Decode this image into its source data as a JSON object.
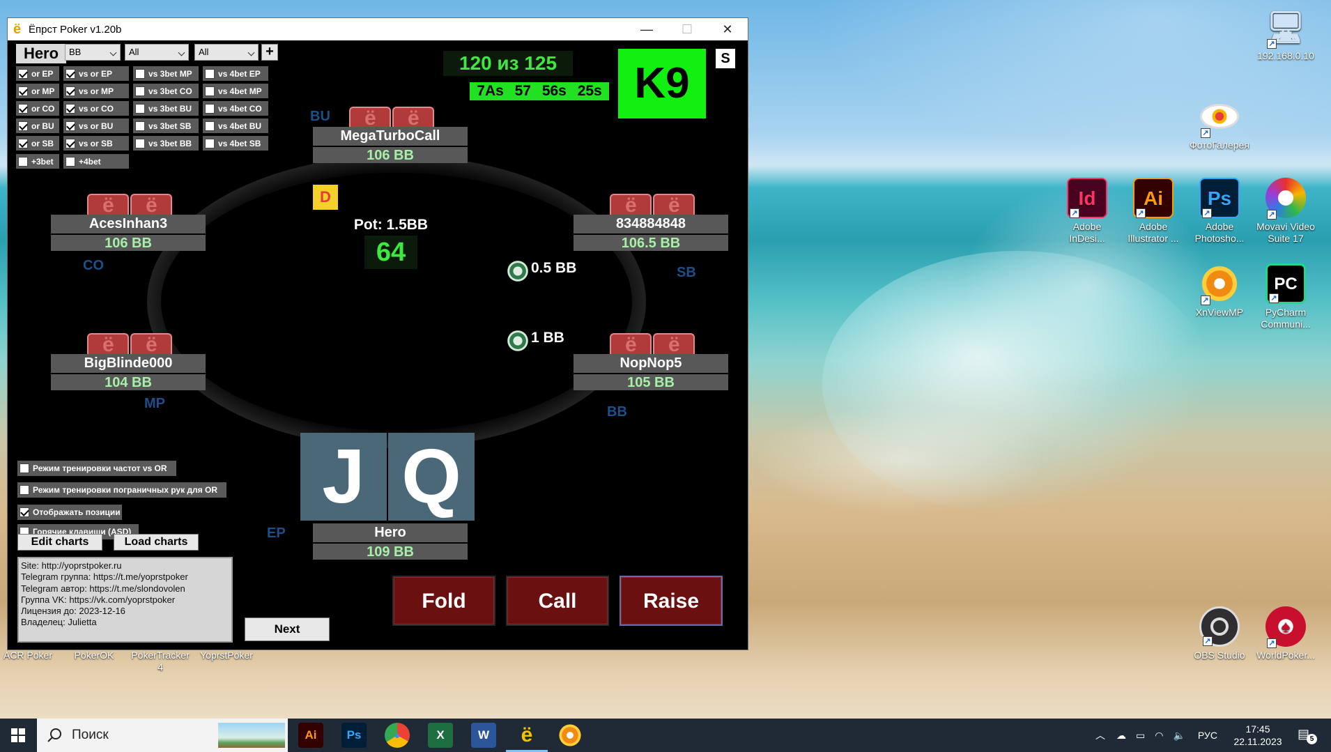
{
  "window": {
    "title": "Ёпрст Poker v1.20b",
    "icon_glyph": "ё",
    "minimize_glyph": "—",
    "maximize_glyph": "☐",
    "close_glyph": "✕"
  },
  "toolbar": {
    "hero_label": "Hero",
    "position_select": "BB",
    "filter_select_1": "All",
    "filter_select_2": "All",
    "add_label": "+"
  },
  "checkboxes": {
    "col1": [
      {
        "label": "or EP",
        "checked": true
      },
      {
        "label": "or MP",
        "checked": true
      },
      {
        "label": "or CO",
        "checked": true
      },
      {
        "label": "or BU",
        "checked": true
      },
      {
        "label": "or SB",
        "checked": true
      }
    ],
    "col2": [
      {
        "label": "vs or EP",
        "checked": true
      },
      {
        "label": "vs or MP",
        "checked": true
      },
      {
        "label": "vs or CO",
        "checked": true
      },
      {
        "label": "vs or BU",
        "checked": true
      },
      {
        "label": "vs or SB",
        "checked": true
      }
    ],
    "col3": [
      {
        "label": "vs 3bet MP",
        "checked": false
      },
      {
        "label": "vs 3bet CO",
        "checked": false
      },
      {
        "label": "vs 3bet BU",
        "checked": false
      },
      {
        "label": "vs 3bet SB",
        "checked": false
      },
      {
        "label": "vs 3bet BB",
        "checked": false
      }
    ],
    "col4": [
      {
        "label": "vs 4bet EP",
        "checked": false
      },
      {
        "label": "vs 4bet MP",
        "checked": false
      },
      {
        "label": "vs 4bet CO",
        "checked": false
      },
      {
        "label": "vs 4bet BU",
        "checked": false
      },
      {
        "label": "vs 4bet SB",
        "checked": false
      }
    ],
    "plus3bet": {
      "label": "+3bet",
      "checked": false
    },
    "plus4bet": {
      "label": "+4bet",
      "checked": false
    }
  },
  "stats": {
    "counter": "120 из 125",
    "line": "7As 57 56s 25s",
    "hand": "K9",
    "s_label": "S"
  },
  "table": {
    "pot": "Pot: 1.5BB",
    "timer": "64",
    "dealer": "D",
    "bets": {
      "sb": "0.5 BB",
      "bb": "1 BB"
    },
    "positions": {
      "bu": "BU",
      "co": "CO",
      "sb": "SB",
      "mp": "MP",
      "bb": "BB",
      "ep": "EP"
    },
    "players": {
      "top": {
        "name": "MegaTurboCall",
        "stack": "106 BB"
      },
      "left_top": {
        "name": "AcesInhan3",
        "stack": "106 BB"
      },
      "right_top": {
        "name": "834884848",
        "stack": "106.5 BB"
      },
      "left_bottom": {
        "name": "BigBlinde000",
        "stack": "104 BB"
      },
      "right_bottom": {
        "name": "NopNop5",
        "stack": "105 BB"
      },
      "hero": {
        "name": "Hero",
        "stack": "109 BB"
      }
    },
    "hero_cards": [
      "J",
      "Q"
    ]
  },
  "options": [
    {
      "label": "Режим тренировки частот vs OR",
      "checked": false
    },
    {
      "label": "Режим тренировки пограничных рук для OR",
      "checked": false
    },
    {
      "label": "Отображать позиции",
      "checked": true
    },
    {
      "label": "Горячие клавиши (ASD)",
      "checked": false
    }
  ],
  "buttons": {
    "edit_charts": "Edit charts",
    "load_charts": "Load charts",
    "next": "Next",
    "fold": "Fold",
    "call": "Call",
    "raise": "Raise"
  },
  "info_lines": [
    "Site: http://yoprstpoker.ru",
    "Telegram группа: https://t.me/yoprstpoker",
    "Telegram автор: https://t.me/slondovolen",
    "Группа VK: https://vk.com/yoprstpoker",
    "Лицензия до: 2023-12-16",
    "Владелец: Julietta"
  ],
  "desktop_icons": [
    {
      "label": "192.168.0.10",
      "glyph": "🖥",
      "color": "#cfe3f5"
    },
    {
      "label": "ФотоГалерея",
      "glyph": "◉",
      "color": "#e8e8e8"
    },
    {
      "label": "Adobe InDesi...",
      "glyph": "Id",
      "color": "#49021f"
    },
    {
      "label": "Adobe Illustrator ...",
      "glyph": "Ai",
      "color": "#330000"
    },
    {
      "label": "Adobe Photosho...",
      "glyph": "Ps",
      "color": "#001e36"
    },
    {
      "label": "Movavi Video Suite 17",
      "glyph": "✿",
      "color": "#ffffff"
    },
    {
      "label": "XnViewMP",
      "glyph": "✺",
      "color": "#f0a010"
    },
    {
      "label": "PyCharm Communi...",
      "glyph": "PC",
      "color": "#000000"
    },
    {
      "label": "OBS Studio",
      "glyph": "◎",
      "color": "#302e31"
    },
    {
      "label": "WorldPoker...",
      "glyph": "♠",
      "color": "#c8102e"
    },
    {
      "label": "ACR Poker",
      "glyph": "",
      "color": ""
    },
    {
      "label": "PokerOK",
      "glyph": "",
      "color": ""
    },
    {
      "label": "PokerTracker 4",
      "glyph": "",
      "color": ""
    },
    {
      "label": "YoprstPoker",
      "glyph": "",
      "color": ""
    }
  ],
  "taskbar": {
    "search_placeholder": "Поиск",
    "apps": [
      {
        "name": "illustrator",
        "glyph": "Ai",
        "color": "#ff9a00",
        "bg": "#330000"
      },
      {
        "name": "photoshop",
        "glyph": "Ps",
        "color": "#31a8ff",
        "bg": "#001e36"
      },
      {
        "name": "chrome",
        "glyph": "●",
        "color": "#fbbc05",
        "bg": ""
      },
      {
        "name": "excel",
        "glyph": "X",
        "color": "#ffffff",
        "bg": "#1d6f42"
      },
      {
        "name": "word",
        "glyph": "W",
        "color": "#ffffff",
        "bg": "#2b579a"
      },
      {
        "name": "yoprst-poker",
        "glyph": "ё",
        "color": "#f3c300",
        "bg": ""
      },
      {
        "name": "xnview",
        "glyph": "✺",
        "color": "#f0a010",
        "bg": ""
      }
    ],
    "lang": "РУС",
    "time": "17:45",
    "date": "22.11.2023",
    "notifications": "5"
  }
}
